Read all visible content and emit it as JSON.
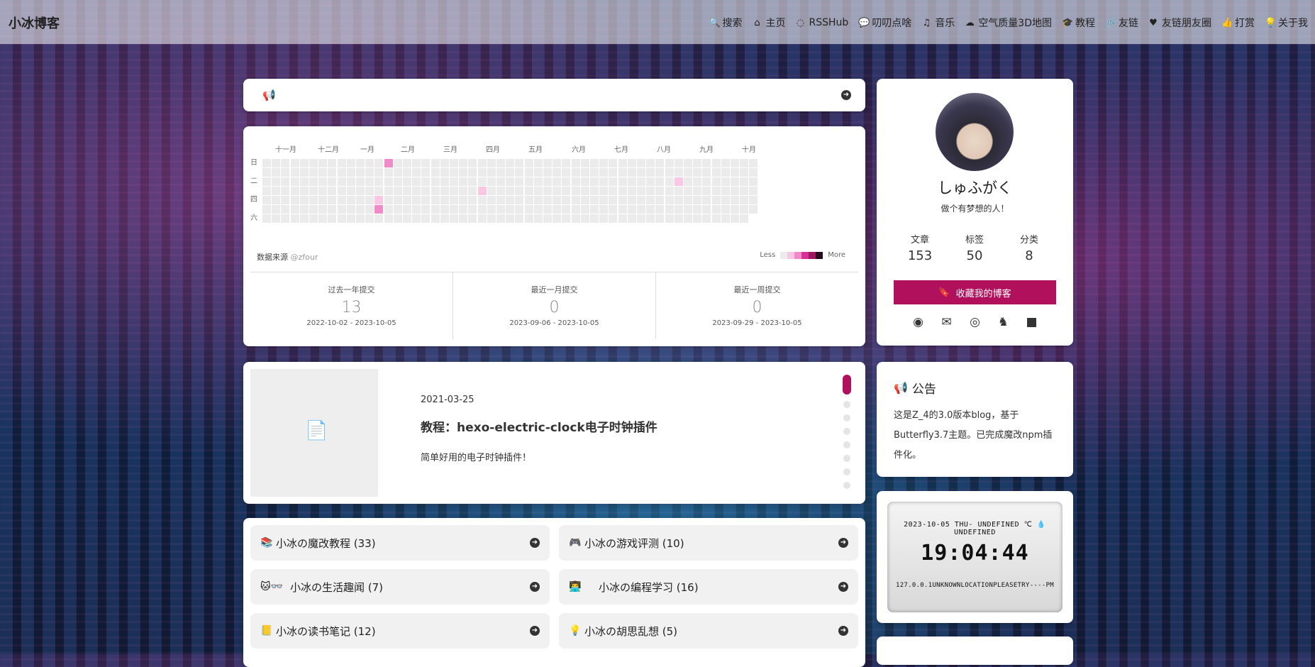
{
  "header": {
    "brand": "小冰博客",
    "menu": [
      {
        "icon": "search-icon",
        "glyph": "🔍",
        "label": "搜索"
      },
      {
        "icon": "home-icon",
        "glyph": "⌂",
        "label": "主页"
      },
      {
        "icon": "rss-icon",
        "glyph": "◌",
        "label": "RSSHub"
      },
      {
        "icon": "comment-icon",
        "glyph": "💬",
        "label": "叨叨点啥"
      },
      {
        "icon": "music-icon",
        "glyph": "♫",
        "label": "音乐"
      },
      {
        "icon": "cloud-icon",
        "glyph": "☁",
        "label": "空气质量3D地图"
      },
      {
        "icon": "graduation-cap-icon",
        "glyph": "🎓",
        "label": "教程"
      },
      {
        "icon": "link-icon",
        "glyph": "🔗",
        "label": "友链"
      },
      {
        "icon": "heartbeat-icon",
        "glyph": "♥",
        "label": "友链朋友圈"
      },
      {
        "icon": "thumbs-up-icon",
        "glyph": "👍",
        "label": "打赏"
      },
      {
        "icon": "lightbulb-icon",
        "glyph": "💡",
        "label": "关于我"
      }
    ]
  },
  "announcement_bar": {
    "icon": "bullhorn-icon",
    "arrow": "➜"
  },
  "calendar": {
    "months": [
      "十一月",
      "十二月",
      "一月",
      "二月",
      "三月",
      "四月",
      "五月",
      "六月",
      "七月",
      "八月",
      "九月",
      "十月"
    ],
    "weekdays": [
      "日",
      "二",
      "四",
      "六"
    ],
    "contributions": [
      {
        "week": 13,
        "day": 0,
        "level": 2
      },
      {
        "week": 12,
        "day": 4,
        "level": 1
      },
      {
        "week": 12,
        "day": 5,
        "level": 2
      },
      {
        "week": 23,
        "day": 3,
        "level": 1
      },
      {
        "week": 44,
        "day": 2,
        "level": 1
      }
    ],
    "source_label": "数据来源",
    "source_handle": "@zfour",
    "legend_less": "Less",
    "legend_more": "More",
    "legend_colors": [
      "#ebebeb",
      "#f9c7e4",
      "#f08ac8",
      "#d6319a",
      "#a0155f",
      "#2b0a1f"
    ],
    "stats": [
      {
        "label": "过去一年提交",
        "value": "13",
        "range": "2022-10-02 - 2023-10-05"
      },
      {
        "label": "最近一月提交",
        "value": "0",
        "range": "2023-09-06 - 2023-10-05"
      },
      {
        "label": "最近一周提交",
        "value": "0",
        "range": "2023-09-29 - 2023-10-05"
      }
    ]
  },
  "featured": {
    "thumb_icon": "document-icon",
    "date": "2021-03-25",
    "title": "教程：hexo-electric-clock电子时钟插件",
    "desc": "简单好用的电子时钟插件！",
    "dot_count": 8,
    "active_index": 0
  },
  "categories": [
    {
      "emoji": "📚",
      "name": "小冰の魔改教程 (33)"
    },
    {
      "emoji": "🎮",
      "name": "小冰の游戏评测 (10)"
    },
    {
      "emoji": "🐱👓",
      "name": "小冰の生活趣闻 (7)"
    },
    {
      "emoji": "👨‍💻",
      "name": "小冰の编程学习 (16)"
    },
    {
      "emoji": "📒",
      "name": "小冰の读书笔记 (12)"
    },
    {
      "emoji": "💡",
      "name": "小冰の胡思乱想 (5)"
    }
  ],
  "profile": {
    "name": "しゅふがく",
    "motto": "做个有梦想的人！",
    "stats": [
      {
        "label": "文章",
        "value": "153"
      },
      {
        "label": "标签",
        "value": "50"
      },
      {
        "label": "分类",
        "value": "8"
      }
    ],
    "bookmark_label": "收藏我的博客",
    "social": [
      {
        "icon": "github-icon",
        "glyph": "◉"
      },
      {
        "icon": "email-icon",
        "glyph": "✉"
      },
      {
        "icon": "weibo-icon",
        "glyph": "◎"
      },
      {
        "icon": "qq-icon",
        "glyph": "♞"
      },
      {
        "icon": "video-icon",
        "glyph": "■"
      }
    ]
  },
  "notice": {
    "title": "公告",
    "body": "这是Z_4的3.0版本blog，基于Butterfly3.7主题。已完成魔改npm插件化。"
  },
  "clock": {
    "top": "2023-10-05 THU- UNDEFINED ℃ 💧 UNDEFINED",
    "time": "19:04:44",
    "bottom": "127.0.0.1UNKNOWNLOCATIONPLEASETRY----PM"
  }
}
